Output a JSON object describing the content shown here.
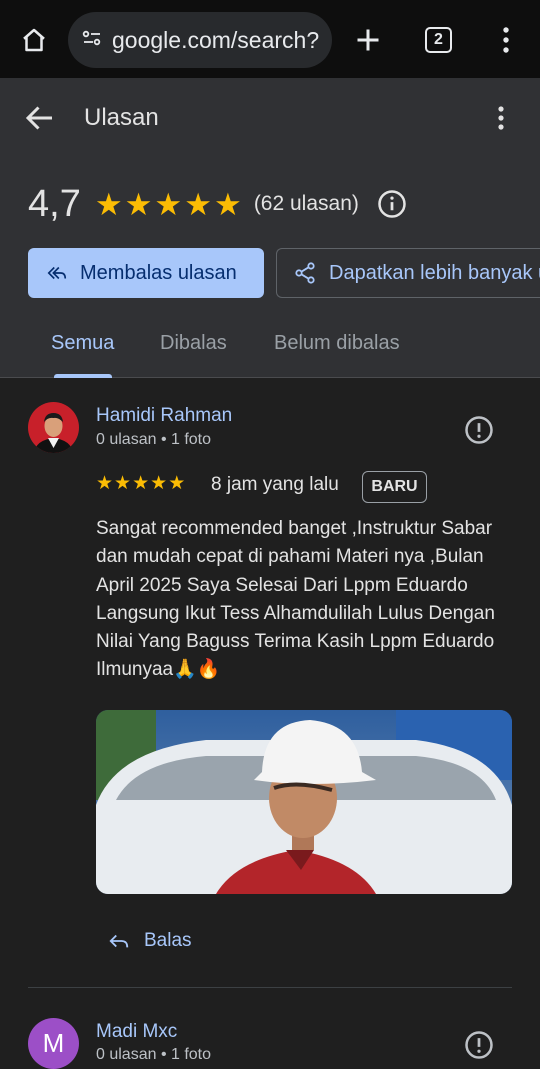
{
  "browser": {
    "url": "google.com/search?",
    "tab_count": "2",
    "icons": [
      "home-icon",
      "site-settings-icon",
      "plus-icon",
      "more-vert-icon"
    ]
  },
  "header": {
    "title": "Ulasan"
  },
  "summary": {
    "rating": "4,7",
    "stars": 5,
    "review_count": "(62 ulasan)"
  },
  "actions": {
    "reply_reviews": "Membalas ulasan",
    "get_more": "Dapatkan lebih banyak ulasan"
  },
  "tabs": [
    {
      "label": "Semua",
      "active": true
    },
    {
      "label": "Dibalas",
      "active": false
    },
    {
      "label": "Belum dibalas",
      "active": false
    }
  ],
  "reviews": [
    {
      "name": "Hamidi Rahman",
      "meta": "0 ulasan • 1 foto",
      "stars": 5,
      "time": "8 jam yang lalu",
      "badge": "BARU",
      "text": "Sangat recommended banget ,Instruktur Sabar dan mudah cepat di pahami Materi nya ,Bulan April 2025 Saya Selesai Dari Lppm Eduardo Langsung Ikut Tess Alhamdulilah Lulus Dengan Nilai Yang Baguss Terima Kasih Lppm Eduardo Ilmunyaa🙏🔥",
      "reply_label": "Balas"
    },
    {
      "name": "Madi Mxc",
      "initial": "M",
      "meta": "0 ulasan • 1 foto"
    }
  ],
  "colors": {
    "accent": "#a8c7fa",
    "star": "#fbbc04",
    "background": "#1f1f1f",
    "panel": "#303134"
  }
}
